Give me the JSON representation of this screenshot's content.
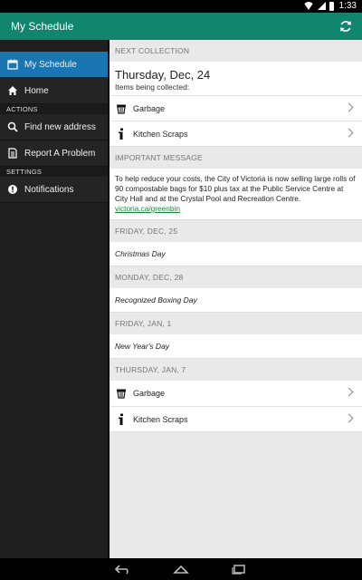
{
  "status_bar": {
    "time": "1:33"
  },
  "action_bar": {
    "title": "My Schedule",
    "refresh_icon": "refresh-icon"
  },
  "drawer": {
    "items": [
      {
        "label": "My Schedule",
        "icon": "calendar-icon",
        "active": true
      },
      {
        "label": "Home",
        "icon": "home-icon"
      }
    ],
    "actions_header": "ACTIONS",
    "actions": [
      {
        "label": "Find new address",
        "icon": "search-icon"
      },
      {
        "label": "Report A Problem",
        "icon": "document-icon"
      }
    ],
    "settings_header": "SETTINGS",
    "settings": [
      {
        "label": "Notifications",
        "icon": "alert-icon"
      }
    ]
  },
  "next_collection": {
    "header": "NEXT COLLECTION",
    "date": "Thursday, Dec, 24",
    "subtitle": "Items being collected:",
    "items": [
      {
        "label": "Garbage",
        "icon": "garbage-can-icon"
      },
      {
        "label": "Kitchen Scraps",
        "icon": "kitchen-scraps-icon"
      }
    ]
  },
  "important_message": {
    "header": "IMPORTANT MESSAGE",
    "text": "To help reduce your costs, the City of Victoria is now selling large rolls of 90 compostable bags for $10 plus tax at the Public Service Centre at City Hall and at the Crystal Pool and Recreation Centre.",
    "link": "victoria.ca/greenbin"
  },
  "schedule": [
    {
      "header": "FRIDAY, DEC, 25",
      "note": "Christmas Day"
    },
    {
      "header": "MONDAY, DEC, 28",
      "note": "Recognized Boxing Day"
    },
    {
      "header": "FRIDAY, JAN, 1",
      "note": "New Year's Day"
    },
    {
      "header": "THURSDAY, JAN, 7",
      "items": [
        {
          "label": "Garbage",
          "icon": "garbage-can-icon"
        },
        {
          "label": "Kitchen Scraps",
          "icon": "kitchen-scraps-icon"
        }
      ]
    }
  ],
  "colors": {
    "action_bar": "#11866f",
    "active_nav": "#1976b0",
    "link": "#138a35"
  }
}
